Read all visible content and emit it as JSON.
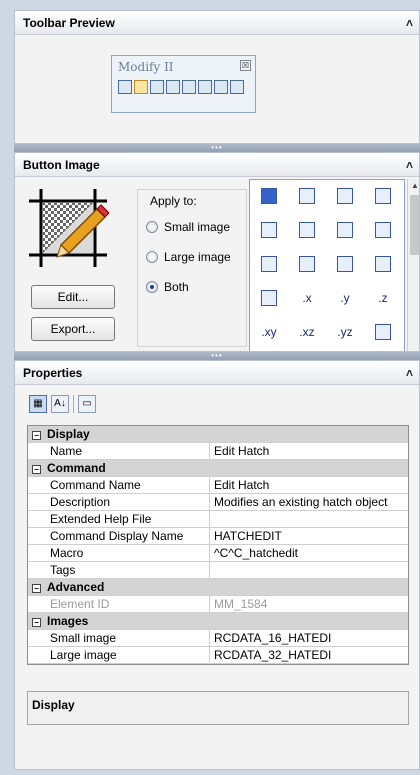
{
  "toolbar_preview": {
    "title": "Toolbar Preview",
    "collapse_glyph": "˄",
    "toolbar_title": "Modify II",
    "close_glyph": "☒",
    "icons": [
      "draworder-icon",
      "hatch-edit-icon",
      "polyline-edit-icon",
      "spline-edit-icon",
      "array-edit-icon",
      "attribute-edit-icon",
      "block-edit-icon",
      "multiline-edit-icon"
    ]
  },
  "button_image": {
    "title": "Button Image",
    "collapse_glyph": "˄",
    "apply_label": "Apply to:",
    "options": [
      "Small image",
      "Large image",
      "Both"
    ],
    "selected_option": "Both",
    "edit_label": "Edit...",
    "export_label": "Export...",
    "grid_labels": [
      ".x",
      ".y",
      ".z",
      ".xy",
      ".xz",
      ".yz"
    ]
  },
  "properties": {
    "title": "Properties",
    "collapse_glyph": "˄",
    "sort_glyph": "A↓",
    "sections": [
      {
        "name": "Display",
        "rows": [
          {
            "k": "Name",
            "v": "Edit Hatch"
          }
        ]
      },
      {
        "name": "Command",
        "rows": [
          {
            "k": "Command Name",
            "v": "Edit Hatch"
          },
          {
            "k": "Description",
            "v": "Modifies an existing hatch object"
          },
          {
            "k": "Extended Help File",
            "v": ""
          },
          {
            "k": "Command Display Name",
            "v": "HATCHEDIT"
          },
          {
            "k": "Macro",
            "v": "^C^C_hatchedit"
          },
          {
            "k": "Tags",
            "v": ""
          }
        ]
      },
      {
        "name": "Advanced",
        "rows": [
          {
            "k": "Element ID",
            "v": "MM_1584"
          }
        ]
      },
      {
        "name": "Images",
        "rows": [
          {
            "k": "Small image",
            "v": "RCDATA_16_HATEDI"
          },
          {
            "k": "Large image",
            "v": "RCDATA_32_HATEDI"
          }
        ]
      }
    ],
    "description_title": "Display"
  },
  "colors": {
    "accent": "#3463c9",
    "panel_bg": "#f3f3f3",
    "category_bg": "#d4d4d4"
  }
}
